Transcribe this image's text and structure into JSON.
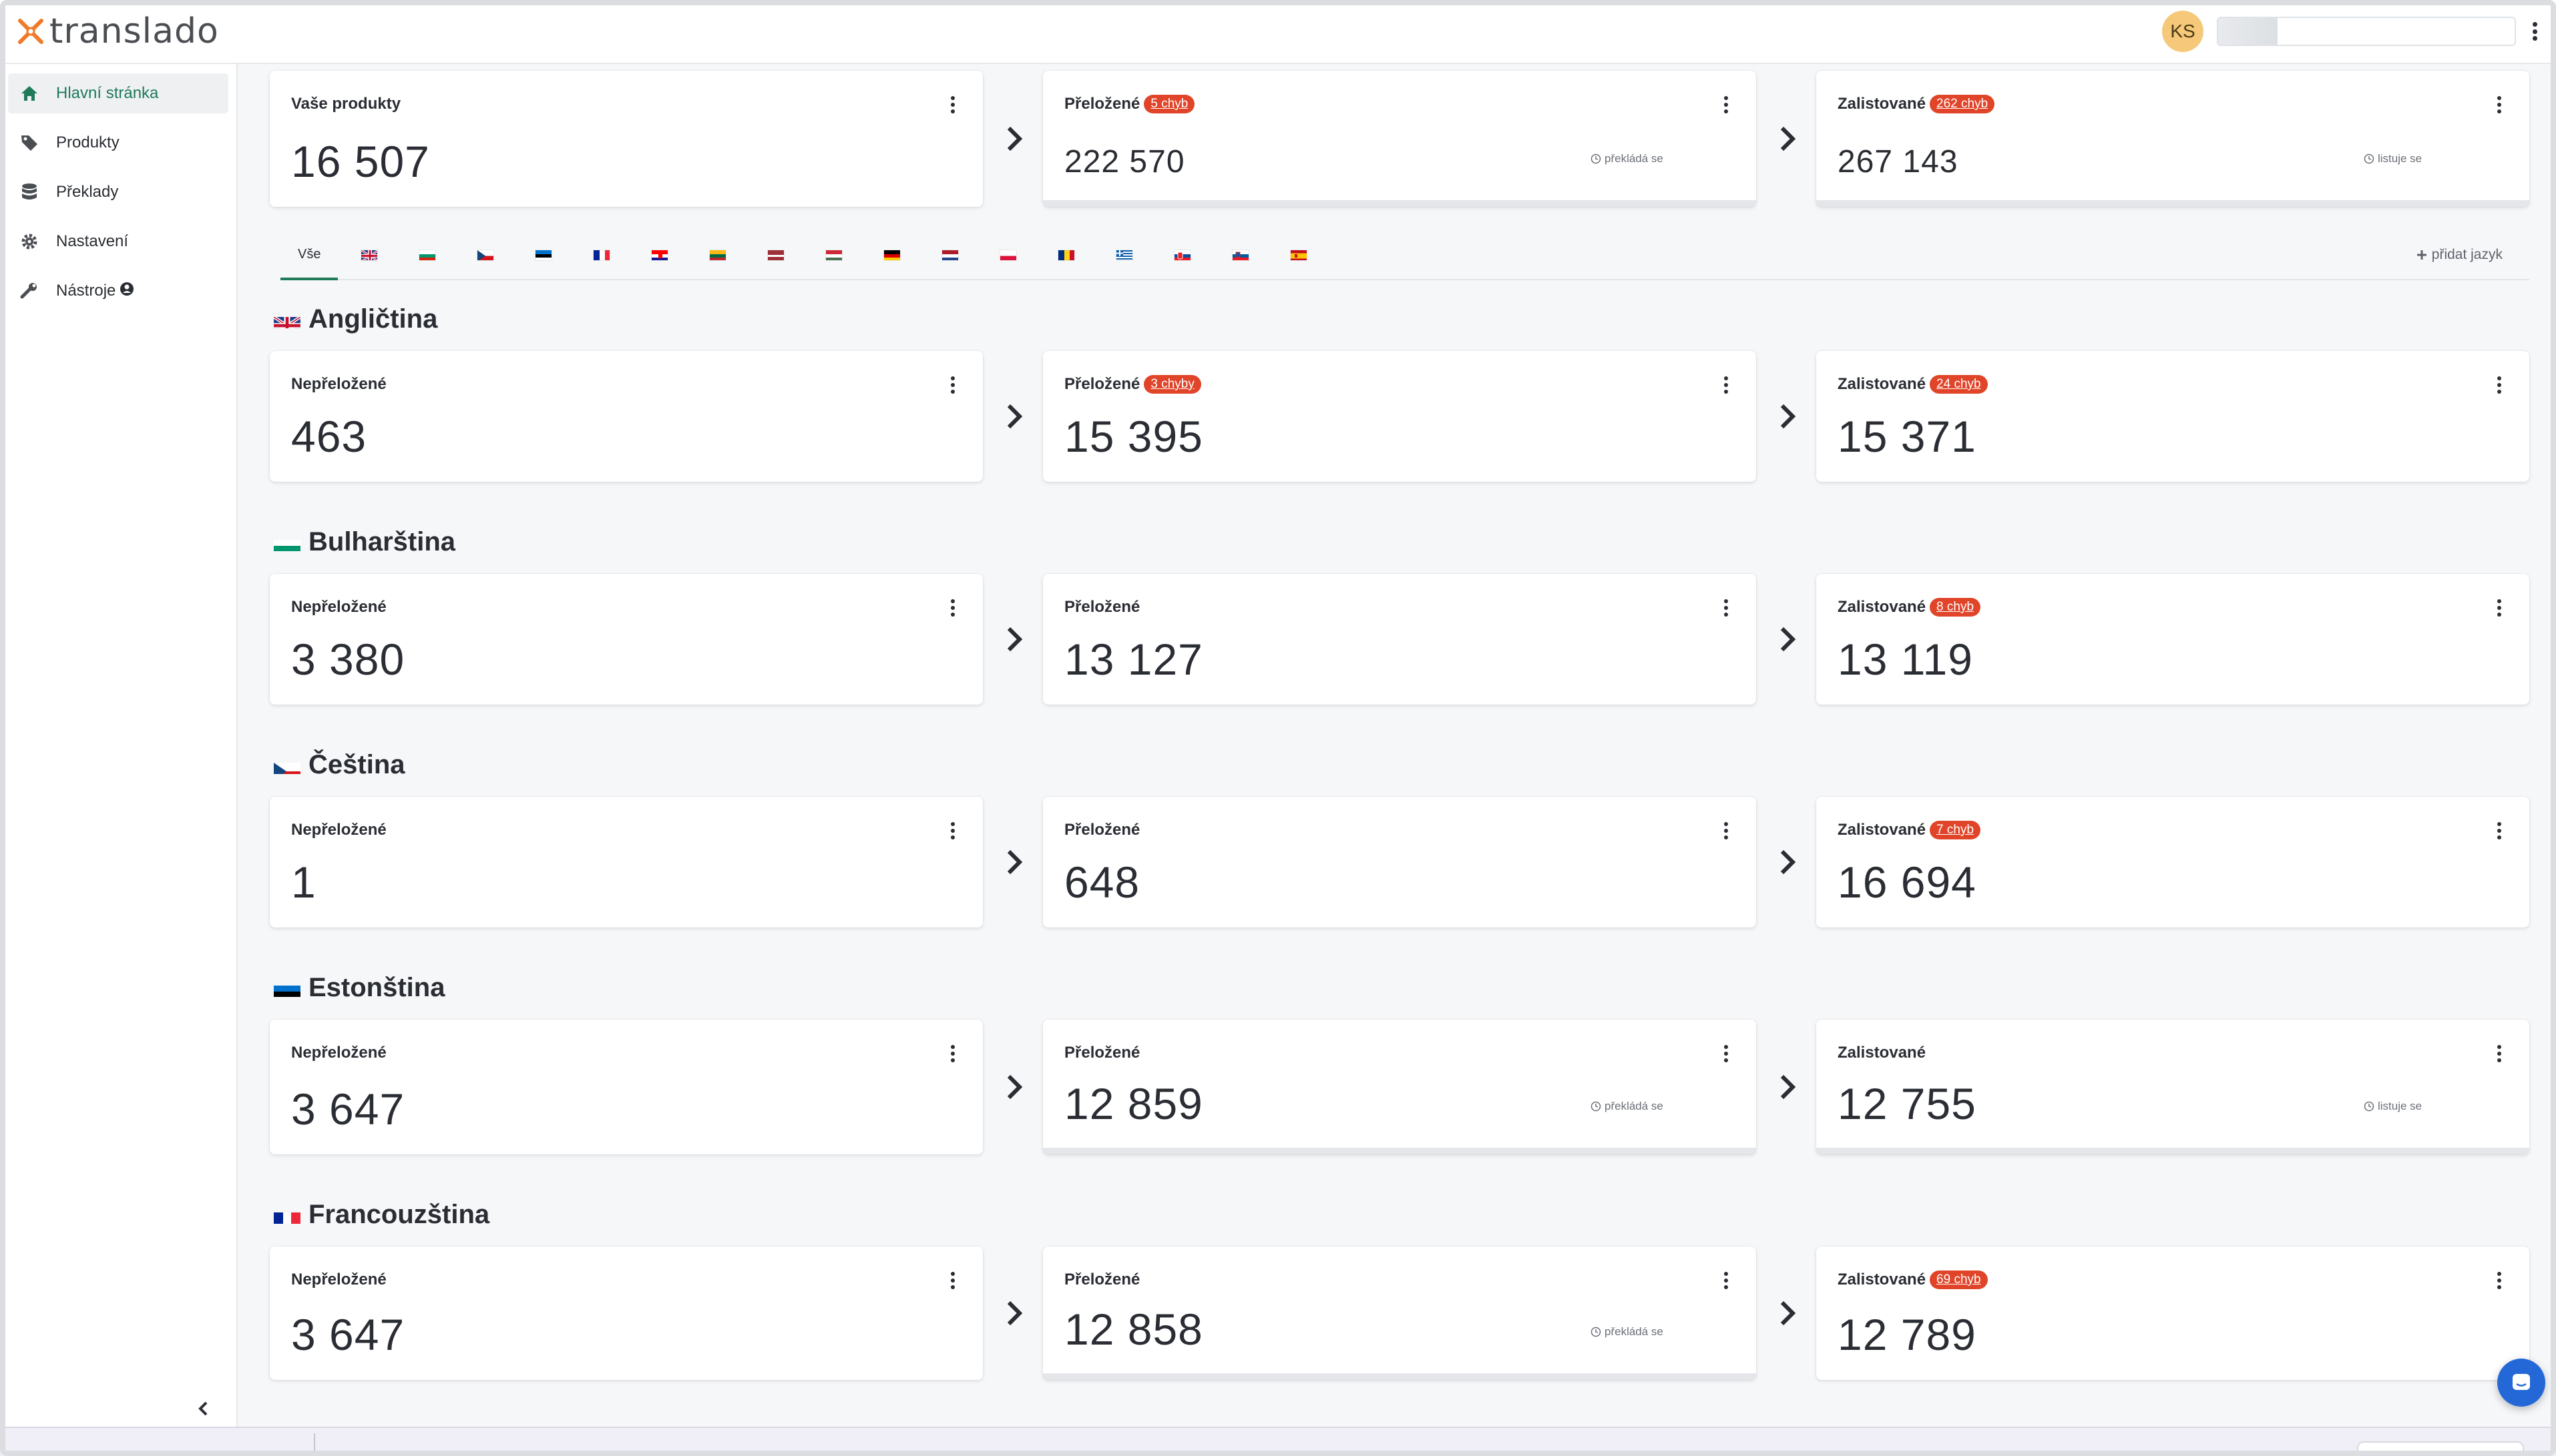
{
  "app": {
    "name": "translado"
  },
  "topbar": {
    "avatar_initials": "KS",
    "progress": 0.2
  },
  "sidebar": {
    "items": [
      {
        "label": "Hlavní stránka",
        "icon": "home-icon",
        "active": true
      },
      {
        "label": "Produkty",
        "icon": "tag-icon",
        "active": false
      },
      {
        "label": "Překlady",
        "icon": "database-icon",
        "active": false
      },
      {
        "label": "Nastavení",
        "icon": "gear-icon",
        "active": false
      },
      {
        "label": "Nástroje",
        "icon": "wrench-icon",
        "active": false
      }
    ]
  },
  "summary": {
    "products_label": "Vaše produkty",
    "products_value": "16 507",
    "translated_label": "Přeložené",
    "translated_badge": "5 chyb",
    "translated_value": "222 570",
    "translated_status": "překládá se",
    "listed_label": "Zalistované",
    "listed_badge": "262 chyb",
    "listed_value": "267 143",
    "listed_status": "listuje se"
  },
  "tabs": {
    "all_label": "Vše",
    "flags": [
      "gb",
      "bg",
      "cz",
      "ee",
      "fr",
      "hr",
      "lt",
      "lv",
      "hu",
      "de",
      "nl",
      "pl",
      "ro",
      "gr",
      "sk",
      "si",
      "es"
    ],
    "add_label": "přidat jazyk"
  },
  "languages": [
    {
      "name": "Angličtina",
      "flag": "gb",
      "untranslated_label": "Nepřeložené",
      "untranslated": "463",
      "translated_label": "Přeložené",
      "translated_badge": "3 chyby",
      "translated": "15 395",
      "translated_status": "",
      "listed_label": "Zalistované",
      "listed_badge": "24 chyb",
      "listed": "15 371",
      "listed_status": ""
    },
    {
      "name": "Bulharština",
      "flag": "bg",
      "untranslated_label": "Nepřeložené",
      "untranslated": "3 380",
      "translated_label": "Přeložené",
      "translated_badge": "",
      "translated": "13 127",
      "translated_status": "",
      "listed_label": "Zalistované",
      "listed_badge": "8 chyb",
      "listed": "13 119",
      "listed_status": ""
    },
    {
      "name": "Čeština",
      "flag": "cz",
      "untranslated_label": "Nepřeložené",
      "untranslated": "1",
      "translated_label": "Přeložené",
      "translated_badge": "",
      "translated": "648",
      "translated_status": "",
      "listed_label": "Zalistované",
      "listed_badge": "7 chyb",
      "listed": "16 694",
      "listed_status": ""
    },
    {
      "name": "Estonština",
      "flag": "ee",
      "untranslated_label": "Nepřeložené",
      "untranslated": "3 647",
      "translated_label": "Přeložené",
      "translated_badge": "",
      "translated": "12 859",
      "translated_status": "překládá se",
      "listed_label": "Zalistované",
      "listed_badge": "",
      "listed": "12 755",
      "listed_status": "listuje se"
    },
    {
      "name": "Francouzština",
      "flag": "fr",
      "untranslated_label": "Nepřeložené",
      "untranslated": "3 647",
      "translated_label": "Přeložené",
      "translated_badge": "",
      "translated": "12 858",
      "translated_status": "překládá se",
      "listed_label": "Zalistované",
      "listed_badge": "69 chyb",
      "listed": "12 789",
      "listed_status": ""
    }
  ],
  "colors": {
    "accent": "#1f7a5a",
    "error_badge": "#e0452a",
    "logo": "#f07a2a"
  }
}
